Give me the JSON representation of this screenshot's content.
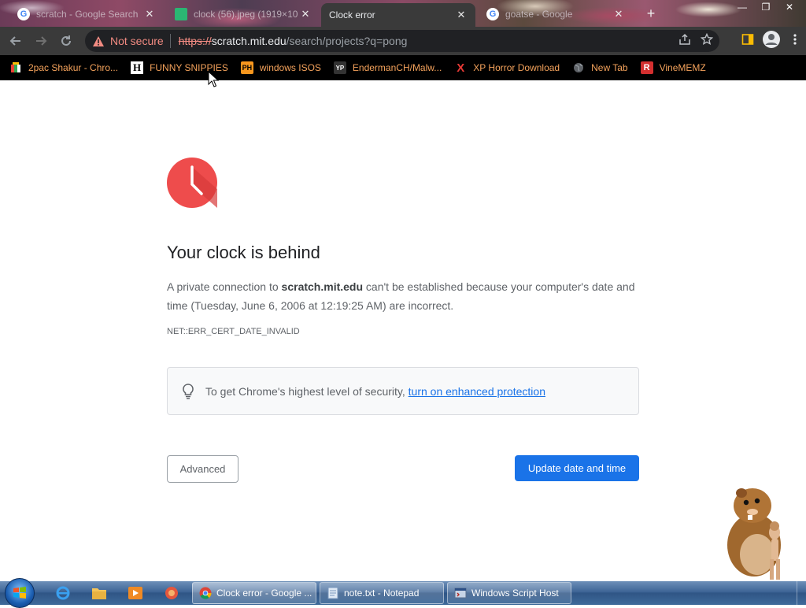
{
  "tabs": [
    {
      "title": "scratch - Google Search",
      "icon": "google-icon"
    },
    {
      "title": "clock (56).jpeg (1919×10",
      "icon": "image-tab-icon"
    },
    {
      "title": "Clock error",
      "icon": "none"
    },
    {
      "title": "goatse - Google",
      "icon": "google-icon"
    }
  ],
  "toolbar": {
    "security_label": "Not secure",
    "url_scheme": "https://",
    "url_host": "scratch.mit.edu",
    "url_path": "/search/projects?q=pong"
  },
  "bookmarks": [
    {
      "label": "2pac Shakur - Chro...",
      "icon": "bookmark-color-icon"
    },
    {
      "label": "FUNNY SNIPPIES",
      "icon": "h-letter-icon"
    },
    {
      "label": "windows ISOS",
      "icon": "ph-icon"
    },
    {
      "label": "EndermanCH/Malw...",
      "icon": "yp-icon"
    },
    {
      "label": "XP Horror Download",
      "icon": "x-icon"
    },
    {
      "label": "New Tab",
      "icon": "globe-icon"
    },
    {
      "label": "VineMEMZ",
      "icon": "r-icon"
    }
  ],
  "page": {
    "heading": "Your clock is behind",
    "para_pre": "A private connection to ",
    "para_host": "scratch.mit.edu",
    "para_post": " can't be established because your computer's date and time (Tuesday, June 6, 2006 at 12:19:25 AM) are incorrect.",
    "error_code": "NET::ERR_CERT_DATE_INVALID",
    "enhanced_text": "To get Chrome's highest level of security, ",
    "enhanced_link": "turn on enhanced protection",
    "advanced_button": "Advanced",
    "update_button": "Update date and time"
  },
  "taskbar": {
    "tasks": [
      {
        "label": "Clock error - Google ...",
        "icon": "chrome-icon"
      },
      {
        "label": "note.txt - Notepad",
        "icon": "notepad-icon"
      },
      {
        "label": "Windows Script Host",
        "icon": "script-host-icon"
      }
    ]
  },
  "colors": {
    "accent": "#1a73e8",
    "clock_red": "#ee4c4c",
    "not_secure": "#f28b82",
    "bookmark_text": "#f5a35c"
  }
}
